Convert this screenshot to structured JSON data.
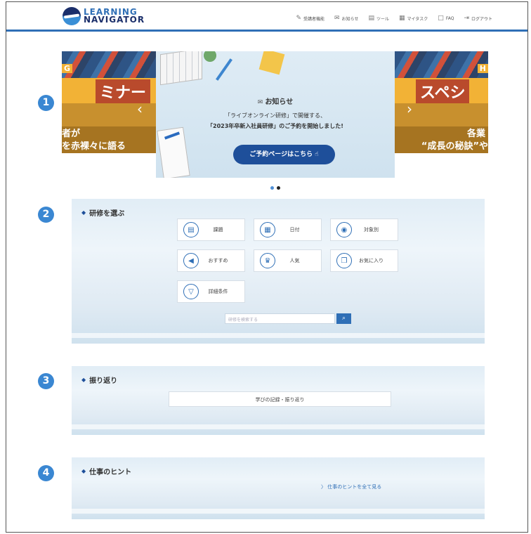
{
  "header": {
    "logo_line1": "LEARNING",
    "logo_line2": "NAVIGATOR",
    "nav": [
      {
        "icon": "pencil-icon",
        "glyph": "✎",
        "label": "受講者機能"
      },
      {
        "icon": "mail-icon",
        "glyph": "✉",
        "label": "お知らせ"
      },
      {
        "icon": "tool-icon",
        "glyph": "▤",
        "label": "ツール"
      },
      {
        "icon": "task-icon",
        "glyph": "▦",
        "label": "マイタスク"
      },
      {
        "icon": "book-icon",
        "glyph": "□",
        "label": "FAQ"
      },
      {
        "icon": "logout-icon",
        "glyph": "⇥",
        "label": "ログアウト"
      }
    ]
  },
  "sections": {
    "n1": "1",
    "n2": "2",
    "n3": "3",
    "n4": "4"
  },
  "carousel": {
    "left_headline": "ミナー",
    "left_sub1": "者が",
    "left_sub2": "を赤裸々に語る",
    "left_tag": "G",
    "right_headline": "スペシ",
    "right_sub1": "各業",
    "right_sub2": "“成長の秘訣”や",
    "right_tag": "H",
    "prev_glyph": "‹",
    "next_glyph": "›",
    "slide_title": "お知らせ",
    "slide_line1": "「ライブオンライン研修」で開催する、",
    "slide_line2": "「2023年卒新入社員研修」のご予約を開始しました!",
    "slide_button": "ご予約ページはこちら",
    "dot_colors": [
      "#4f8fd6",
      "#222222"
    ]
  },
  "training": {
    "title": "研修を選ぶ",
    "tiles": [
      {
        "icon": "task-list-icon",
        "glyph": "▤",
        "label": "課題"
      },
      {
        "icon": "calendar-icon",
        "glyph": "▦",
        "label": "日付"
      },
      {
        "icon": "person-icon",
        "glyph": "◉",
        "label": "対象別"
      },
      {
        "icon": "megaphone-icon",
        "glyph": "◀",
        "label": "おすすめ"
      },
      {
        "icon": "crown-icon",
        "glyph": "♛",
        "label": "人気"
      },
      {
        "icon": "bookmark-icon",
        "glyph": "❒",
        "label": "お気に入り"
      },
      {
        "icon": "filter-icon",
        "glyph": "▽",
        "label": "詳細条件"
      }
    ],
    "search_placeholder": "研修を検索する",
    "search_glyph": "⌕"
  },
  "reflection": {
    "title": "振り返り",
    "button": "学びの記録・振り返り"
  },
  "hints": {
    "title": "仕事のヒント",
    "link": "〉 仕事のヒントを全て見る"
  },
  "colors": {
    "accent": "#2f6fb6",
    "badge": "#3a87d2",
    "button_dark": "#1e4f9a"
  }
}
